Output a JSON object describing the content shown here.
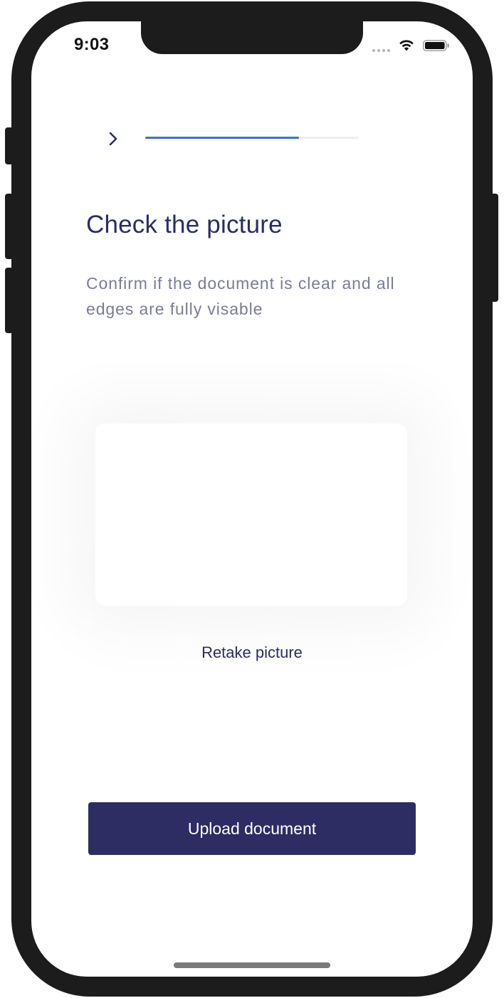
{
  "status_bar": {
    "time": "9:03",
    "icons": [
      "signal-dots-icon",
      "wifi-icon",
      "battery-icon"
    ]
  },
  "nav": {
    "back_icon": "chevron-right-icon",
    "progress_fraction": 0.72,
    "progress_color": "#3f6fd8",
    "track_color": "#eeeeee"
  },
  "main": {
    "title": "Check the picture",
    "subtitle": "Confirm if the document is clear and all edges are fully visable",
    "retake_label": "Retake picture"
  },
  "footer": {
    "upload_label": "Upload document"
  },
  "colors": {
    "primary": "#2d2d63",
    "title_text": "#2b2d63",
    "subtitle_text": "#7a7c96",
    "accent": "#3f6fd8"
  }
}
